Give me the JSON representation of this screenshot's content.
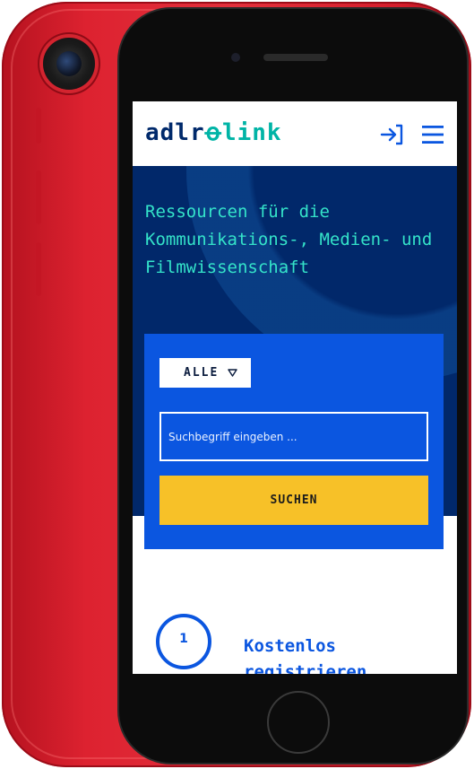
{
  "colors": {
    "phone_red": "#d71f2d",
    "brand_navy": "#00296b",
    "brand_teal": "#00b4a6",
    "hero_bg": "#01286a",
    "hero_text": "#34e3c9",
    "search_panel": "#0b56e0",
    "search_button": "#f7c128"
  },
  "header": {
    "logo": {
      "part1": "adlr",
      "mark": "ꝋ",
      "part2": "link"
    },
    "icons": [
      "login-icon",
      "menu-icon"
    ]
  },
  "hero": {
    "title": "Ressourcen für die Kommunikations-, Medien- und Filmwissenschaft"
  },
  "search": {
    "scope_selected": "ALLE",
    "input_placeholder": "Suchbegriff eingeben ...",
    "button_label": "SUCHEN"
  },
  "steps": [
    {
      "number": "1",
      "title": "Kostenlos registrieren"
    }
  ]
}
